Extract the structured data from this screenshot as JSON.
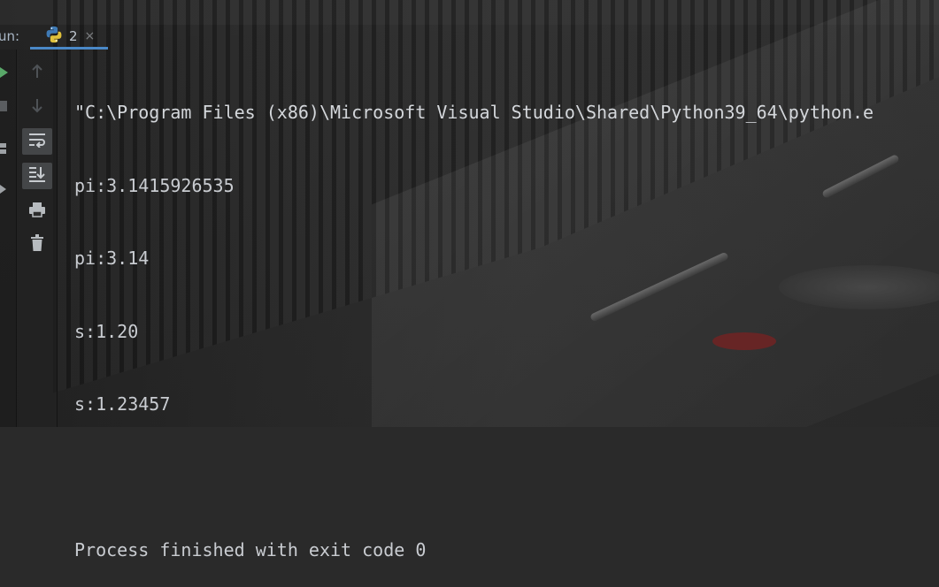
{
  "run_panel": {
    "label": "un:",
    "tab": {
      "name": "2",
      "close_icon": "×",
      "icon": "python-icon"
    }
  },
  "toolbar": {
    "buttons": [
      {
        "name": "scroll-up-icon",
        "active": false
      },
      {
        "name": "scroll-down-icon",
        "active": false
      },
      {
        "name": "soft-wrap-icon",
        "active": true
      },
      {
        "name": "scroll-to-end-icon",
        "active": true
      },
      {
        "name": "print-icon",
        "active": false
      },
      {
        "name": "trash-icon",
        "active": false
      }
    ]
  },
  "console": {
    "command": "\"C:\\Program Files (x86)\\Microsoft Visual Studio\\Shared\\Python39_64\\python.e",
    "lines": [
      "pi:3.1415926535",
      "pi:3.14",
      "s:1.20",
      "s:1.23457",
      "",
      "Process finished with exit code 0"
    ]
  },
  "colors": {
    "accent": "#4a88c7",
    "text": "#c9ccd1",
    "run_green": "#59a869"
  }
}
